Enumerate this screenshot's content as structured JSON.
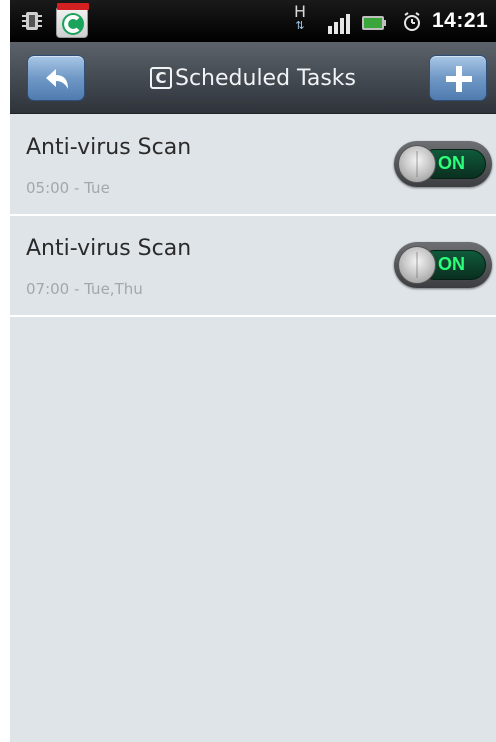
{
  "status_bar": {
    "network_type": "H",
    "time": "14:21",
    "icons": [
      "chip-icon",
      "comodo-app-icon",
      "signal-icon",
      "battery-icon",
      "alarm-clock-icon"
    ]
  },
  "titlebar": {
    "title": "Scheduled Tasks",
    "logo_letter": "C",
    "back_icon": "back-arrow-icon",
    "add_icon": "plus-icon"
  },
  "tasks": [
    {
      "name": "Anti-virus Scan",
      "schedule": "05:00  -  Tue",
      "toggle": "ON"
    },
    {
      "name": "Anti-virus Scan",
      "schedule": "07:00  -  Tue,Thu",
      "toggle": "ON"
    }
  ],
  "colors": {
    "background": "#dfe4e9",
    "titlebar": "#474d55",
    "button_blue": "#6f98c6",
    "toggle_on_text": "#2cff7a"
  }
}
